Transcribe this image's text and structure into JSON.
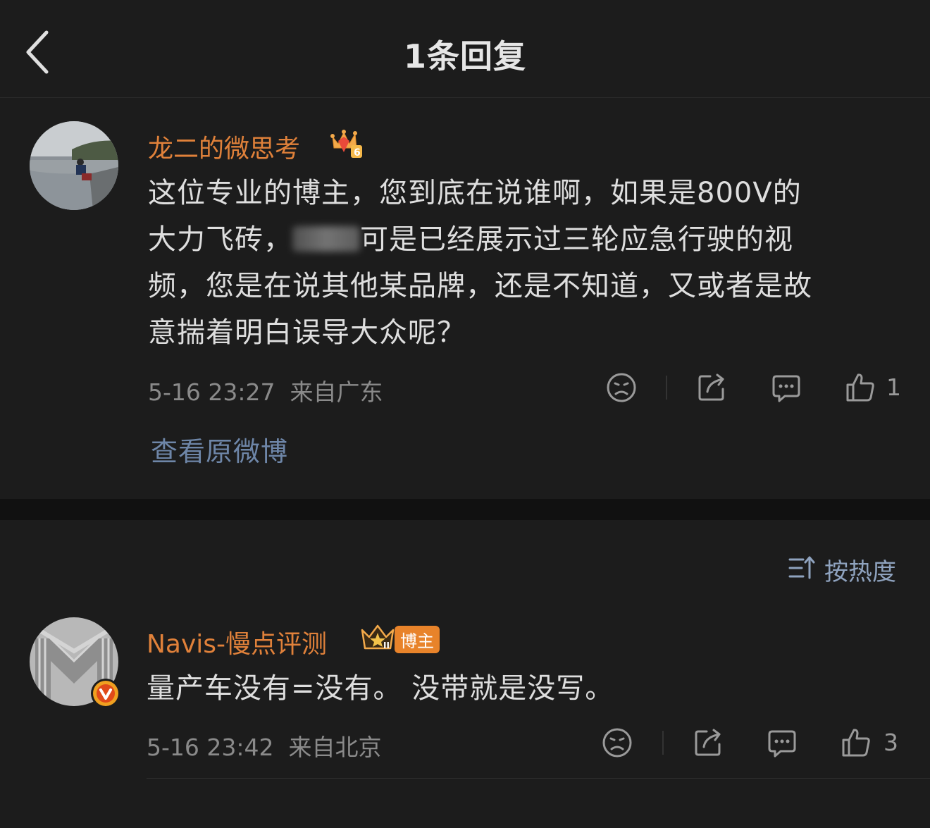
{
  "header": {
    "title": "1条回复"
  },
  "root_comment": {
    "username": "龙二的微思考",
    "text": "这位专业的博主，您到底在说谁啊，如果是800V的大力飞砖，Lixxs 可是已经展示过三轮应急行驶的视频，您是在说其他某品牌，还是不知道，又或者是故意揣着明白误导大众呢？",
    "line1": "这位专业的博主，您到底在说谁啊，如果是800V的",
    "line2_a": "大力飞砖，",
    "line2_b": "可是已经展示过三轮应急行驶的视",
    "line3": "频，您是在说其他某品牌，还是不知道，又或者是故",
    "line4": "意揣着明白误导大众呢？",
    "date": "5-16 23:27",
    "location": "来自广东",
    "like_count": "1",
    "view_original": "查看原微博"
  },
  "sort": {
    "label": "按热度"
  },
  "reply": {
    "username": "Navis-慢点评测",
    "badge": "博主",
    "text": "量产车没有=没有。 没带就是没写。",
    "date": "5-16 23:42",
    "location": "来自北京",
    "like_count": "3"
  },
  "colors": {
    "background": "#1c1c1c",
    "username": "#e0813a",
    "link": "#6e86a8",
    "verified_badge": "#f0a020"
  }
}
